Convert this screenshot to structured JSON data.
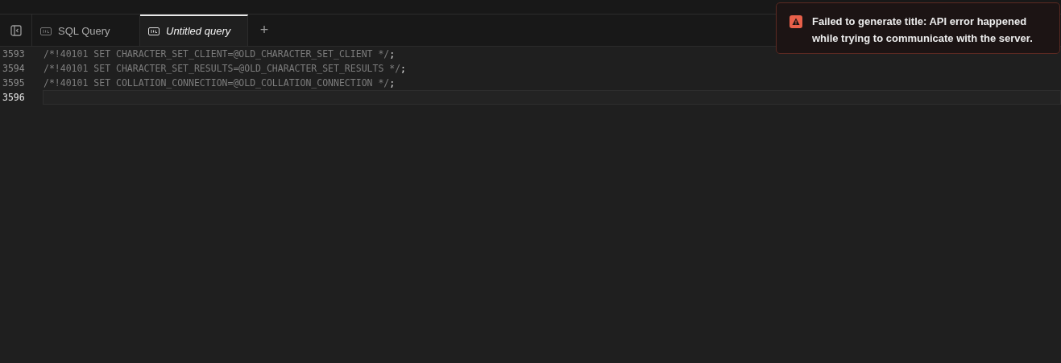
{
  "tabs": [
    {
      "label": "SQL Query",
      "selected": false
    },
    {
      "label": "Untitled query",
      "selected": true
    }
  ],
  "new_tab": "+",
  "editor": {
    "lines": [
      {
        "number": "3593",
        "code": "/*!40101 SET CHARACTER_SET_CLIENT=@OLD_CHARACTER_SET_CLIENT */",
        "terminator": ";",
        "current": false
      },
      {
        "number": "3594",
        "code": "/*!40101 SET CHARACTER_SET_RESULTS=@OLD_CHARACTER_SET_RESULTS */",
        "terminator": ";",
        "current": false
      },
      {
        "number": "3595",
        "code": "/*!40101 SET COLLATION_CONNECTION=@OLD_COLLATION_CONNECTION */",
        "terminator": ";",
        "current": false
      },
      {
        "number": "3596",
        "current": true
      }
    ]
  },
  "toast": {
    "kind": "error",
    "message": "Failed to generate title: API error happened while trying to communicate with the server."
  }
}
